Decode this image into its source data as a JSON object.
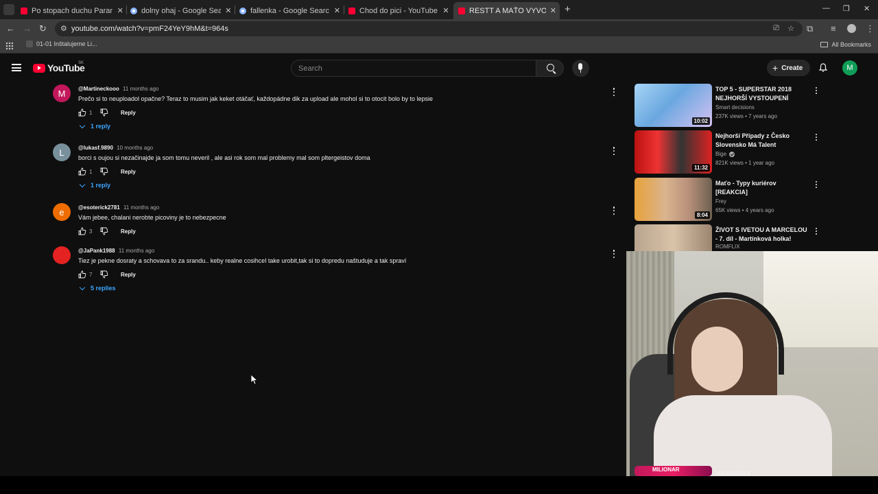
{
  "browser": {
    "tabs": [
      {
        "title": "Po stopach duchu Paranormal",
        "favicon": "youtube",
        "active": false
      },
      {
        "title": "dolny ohaj - Google Search",
        "favicon": "google",
        "active": false
      },
      {
        "title": "fallenka - Google Search",
        "favicon": "google",
        "active": false
      },
      {
        "title": "Chod do pici - YouTube",
        "favicon": "youtube",
        "active": false
      },
      {
        "title": "RESTT A MAŤO VYVOLÁVAJÚ D",
        "favicon": "youtube",
        "active": true
      }
    ],
    "url": "youtube.com/watch?v=pmF24YeY9hM&t=964s",
    "bookmark_item": "01-01 Inštalujeme Li...",
    "all_bookmarks": "All Bookmarks"
  },
  "youtube_header": {
    "logo_text": "YouTube",
    "country_code": "SK",
    "search_placeholder": "Search",
    "create_label": "Create",
    "avatar_letter": "M"
  },
  "comments": [
    {
      "avatar_letter": "M",
      "avatar_color": "#c2185b",
      "author": "@Martineckooo",
      "time": "11 months ago",
      "text": "Prečo si to neuploadol opačne? Teraz to musim jak keket otáčať, každopádne dik za upload ale mohol si to otocit bolo by to lepsie",
      "likes": "1",
      "reply_label": "Reply",
      "replies": "1 reply"
    },
    {
      "avatar_letter": "L",
      "avatar_color": "#78909c",
      "author": "@lukasf.9890",
      "time": "10 months ago",
      "text": "borci s oujou si nezačinajde ja som tomu neveril , ale asi rok som mal problemy mal som pltergeistov  doma",
      "likes": "1",
      "reply_label": "Reply",
      "replies": "1 reply"
    },
    {
      "avatar_letter": "e",
      "avatar_color": "#ef6c00",
      "author": "@esoterick2781",
      "time": "11 months ago",
      "text": "Vám jebee, chalani nerobte picoviny je to nebezpecne",
      "likes": "3",
      "reply_label": "Reply",
      "replies": ""
    },
    {
      "avatar_letter": "",
      "avatar_color": "#e52222",
      "author": "@JaPank1988",
      "time": "11 months ago",
      "text": "Tiez je pekne dosraty a schovava to za srandu.. keby realne cosihcel take urobit,tak si to dopredu naštuduje a tak spraví",
      "likes": "7",
      "reply_label": "Reply",
      "replies": "5 replies"
    }
  ],
  "recommendations": [
    {
      "title": "TOP 5  - SUPERSTAR 2018 NEJHORŠÍ VYSTOUPENÍ",
      "channel": "Smart decisions",
      "verified": false,
      "meta": "237K views • 7 years ago",
      "duration": "10:02"
    },
    {
      "title": "Nejhorší Případy z Česko Slovensko Má Talent",
      "channel": "Bige",
      "verified": true,
      "meta": "821K views • 1 year ago",
      "duration": "11:32"
    },
    {
      "title": "Maťo - Typy kuriérov [REAKCIA]",
      "channel": "Frey",
      "verified": false,
      "meta": "65K views • 4 years ago",
      "duration": "8:04"
    },
    {
      "title": "ŽIVOT S IVETOU A MARCELOU - 7. díl - Martínková holka!",
      "channel": "ROMFLIX",
      "verified": false,
      "meta": "",
      "duration": ""
    },
    {
      "title": "MILIONÁRA",
      "channel": "",
      "verified": false,
      "meta": "",
      "duration": ""
    }
  ],
  "overlay_thumb_text": "MILIONAR"
}
